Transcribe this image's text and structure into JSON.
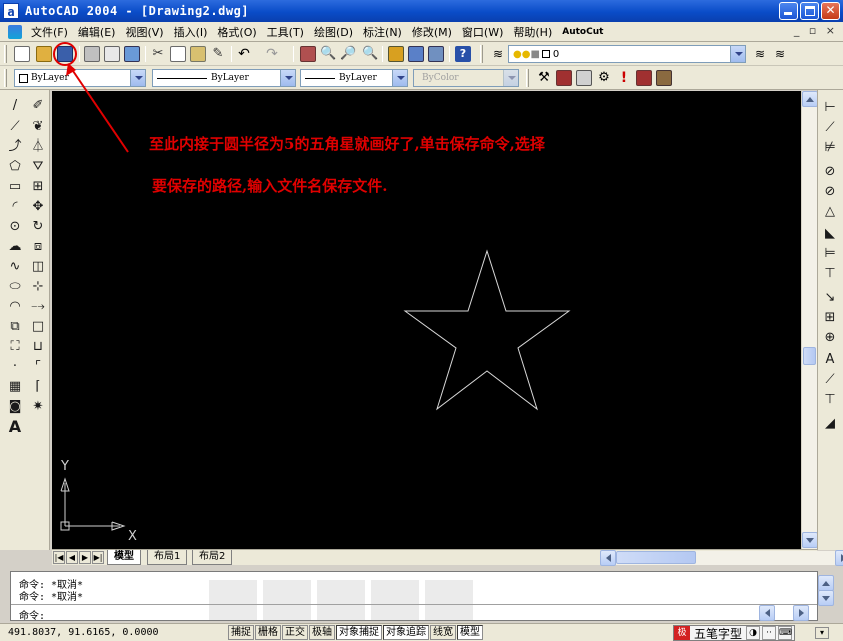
{
  "window": {
    "app_icon": "a",
    "title": "AutoCAD 2004 - [Drawing2.dwg]",
    "colors": {
      "title_bar": "#0a4cc8",
      "close": "#c43a17",
      "canvas": "#000000",
      "annotation": "#e00000"
    }
  },
  "menu": {
    "items": [
      "文件(F)",
      "编辑(E)",
      "视图(V)",
      "插入(I)",
      "格式(O)",
      "工具(T)",
      "绘图(D)",
      "标注(N)",
      "修改(M)",
      "窗口(W)",
      "帮助(H)",
      "AutoCut"
    ],
    "mdi_controls": "_ ▫ ×"
  },
  "properties_toolbar": {
    "layer_value": "0",
    "color": "ByLayer",
    "linetype": "ByLayer",
    "lineweight": "ByLayer",
    "plotstyle": "ByColor"
  },
  "annotation": {
    "line1": "至此内接于圆半径为5的五角星就画好了,单击保存命令,选择",
    "line2": "要保存的路径,输入文件名保存文件."
  },
  "canvas": {
    "ucs_x": "X",
    "ucs_y": "Y",
    "text_tool": "A"
  },
  "layout_tabs": {
    "nav": [
      "|◀",
      "◀",
      "▶",
      "▶|"
    ],
    "tabs": [
      "模型",
      "布局1",
      "布局2"
    ],
    "active": "模型"
  },
  "command_window": {
    "lines": [
      "命令: *取消*",
      "命令: *取消*"
    ],
    "prompt": "命令:"
  },
  "status_bar": {
    "coordinates": "491.8037, 91.6165, 0.0000",
    "toggles": [
      "捕捉",
      "栅格",
      "正交",
      "极轴",
      "对象捕捉",
      "对象追踪",
      "线宽",
      "模型"
    ],
    "toggles_on": [
      "对象捕捉",
      "对象追踪",
      "模型"
    ],
    "ime_logo": "极",
    "ime_label": "五笔字型"
  }
}
